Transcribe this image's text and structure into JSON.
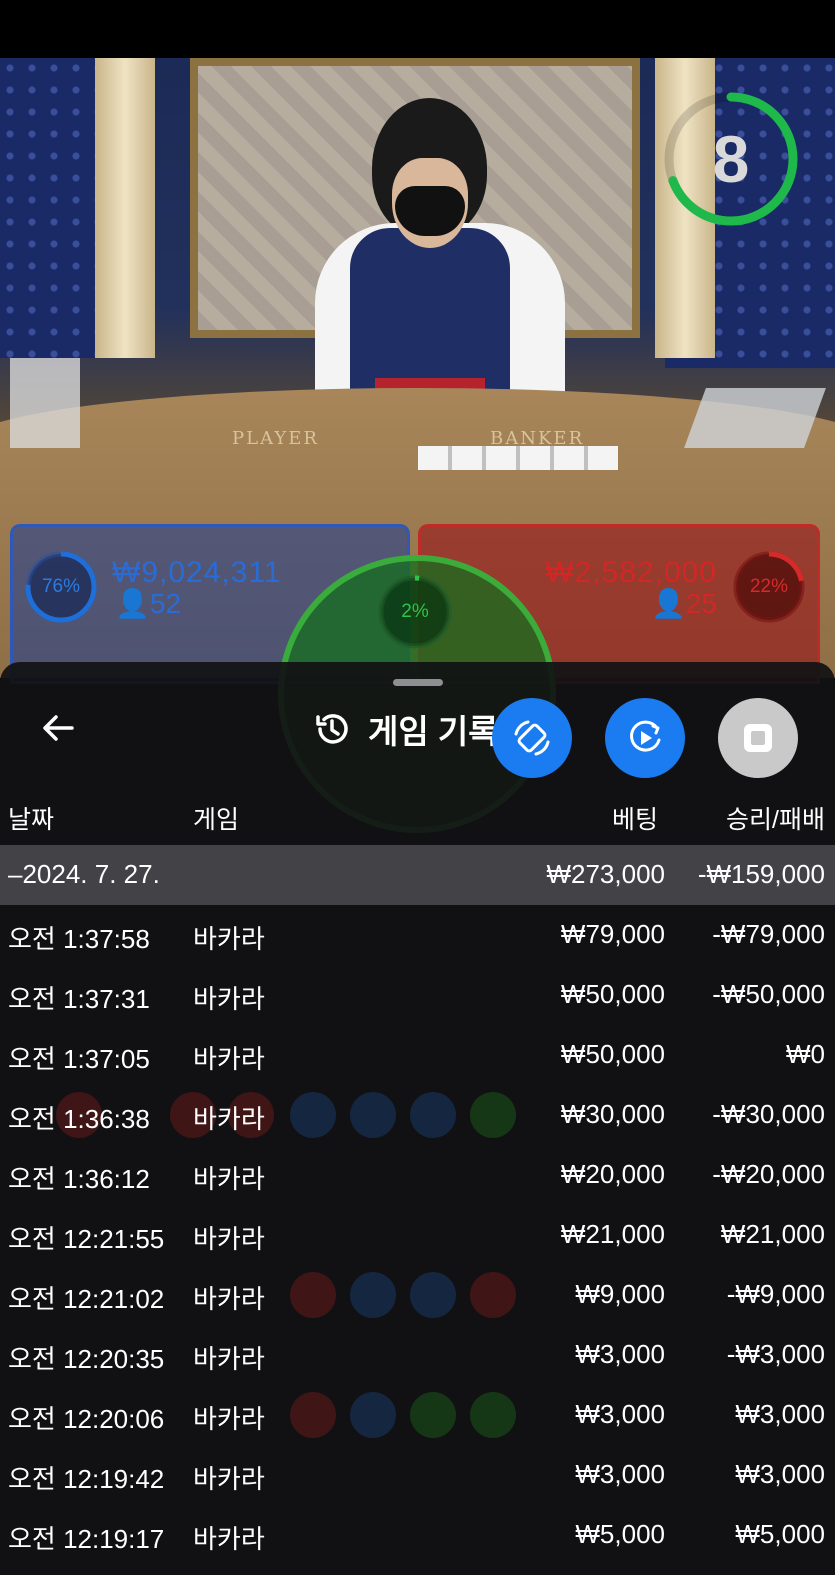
{
  "live_stream": {
    "countdown": "8",
    "table_labels": {
      "player": "PLAYER",
      "banker": "BANKER"
    }
  },
  "bets": {
    "player": {
      "percent": "76%",
      "amount": "₩9,024,311",
      "count": "52",
      "fraction": 0.76
    },
    "banker": {
      "percent": "22%",
      "amount": "₩2,582,000",
      "count": "25",
      "fraction": 0.22
    },
    "tie": {
      "percent": "2%",
      "fraction": 0.02
    }
  },
  "history_panel": {
    "title": "게임 기록",
    "columns": {
      "date": "날짜",
      "game": "게임",
      "bet": "베팅",
      "result": "승리/패배"
    },
    "date_group": {
      "date": "–2024. 7. 27.",
      "bet_total": "₩273,000",
      "result_total": "-₩159,000"
    },
    "rows": [
      {
        "time": "오전 1:37:58",
        "game": "바카라",
        "bet": "₩79,000",
        "result": "-₩79,000"
      },
      {
        "time": "오전 1:37:31",
        "game": "바카라",
        "bet": "₩50,000",
        "result": "-₩50,000"
      },
      {
        "time": "오전 1:37:05",
        "game": "바카라",
        "bet": "₩50,000",
        "result": "₩0"
      },
      {
        "time": "오전 1:36:38",
        "game": "바카라",
        "bet": "₩30,000",
        "result": "-₩30,000"
      },
      {
        "time": "오전 1:36:12",
        "game": "바카라",
        "bet": "₩20,000",
        "result": "-₩20,000"
      },
      {
        "time": "오전 12:21:55",
        "game": "바카라",
        "bet": "₩21,000",
        "result": "₩21,000"
      },
      {
        "time": "오전 12:21:02",
        "game": "바카라",
        "bet": "₩9,000",
        "result": "-₩9,000"
      },
      {
        "time": "오전 12:20:35",
        "game": "바카라",
        "bet": "₩3,000",
        "result": "-₩3,000"
      },
      {
        "time": "오전 12:20:06",
        "game": "바카라",
        "bet": "₩3,000",
        "result": "₩3,000"
      },
      {
        "time": "오전 12:19:42",
        "game": "바카라",
        "bet": "₩3,000",
        "result": "₩3,000"
      },
      {
        "time": "오전 12:19:17",
        "game": "바카라",
        "bet": "₩5,000",
        "result": "₩5,000"
      }
    ]
  },
  "floating_controls": {
    "rotate_icon": "screen-rotate-icon",
    "record_icon": "screen-record-icon",
    "stop_icon": "stop-icon"
  },
  "colors": {
    "player_blue": "#1f5fc8",
    "banker_red": "#c8262d",
    "tie_green": "#2fc24a",
    "fab_blue": "#1a7cf0",
    "timer_green": "#1fb84a"
  }
}
